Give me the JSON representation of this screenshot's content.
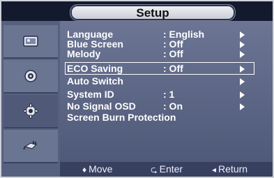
{
  "title": "Setup",
  "sidebar": {
    "items": [
      {
        "icon": "picture-icon"
      },
      {
        "icon": "sound-icon"
      },
      {
        "icon": "setup-gear-icon",
        "active": true
      },
      {
        "icon": "input-plug-icon"
      }
    ]
  },
  "menu": {
    "items": [
      {
        "label": "Language",
        "value": ": English",
        "arrow": true
      },
      {
        "label": "Blue Screen",
        "value": ": Off",
        "arrow": true
      },
      {
        "label": "Melody",
        "value": ": Off",
        "arrow": true
      },
      {
        "label": "ECO Saving",
        "value": ": Off",
        "arrow": true,
        "selected": true
      },
      {
        "label": "Auto Switch",
        "value": "",
        "arrow": true
      },
      {
        "label": "System ID",
        "value": ": 1",
        "arrow": true
      },
      {
        "label": "No Signal OSD",
        "value": ": On",
        "arrow": true
      },
      {
        "label": "Screen Burn Protection",
        "value": "",
        "arrow": false
      }
    ]
  },
  "footer": {
    "move": {
      "symbol": "♦",
      "label": "Move"
    },
    "enter": {
      "symbol": "⮎",
      "label": "Enter"
    },
    "return": {
      "symbol": "◂",
      "label": "Return"
    }
  }
}
